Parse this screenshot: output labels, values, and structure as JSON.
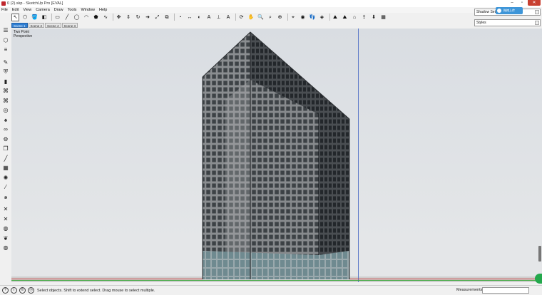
{
  "window": {
    "title": "0 (2).skp - SketchUp Pro [EVAL]",
    "minimize": "–",
    "maximize": "▫",
    "close": "✕"
  },
  "menu": [
    "File",
    "Edit",
    "View",
    "Camera",
    "Draw",
    "Tools",
    "Window",
    "Help"
  ],
  "toolbar": [
    {
      "name": "select-icon",
      "glyph": "↖",
      "selected": true
    },
    {
      "name": "make-component-icon",
      "glyph": "⬡"
    },
    {
      "name": "paint-bucket-icon",
      "glyph": "🪣"
    },
    {
      "name": "eraser-icon",
      "glyph": "◧"
    },
    {
      "sep": true
    },
    {
      "name": "rectangle-icon",
      "glyph": "▭"
    },
    {
      "name": "line-icon",
      "glyph": "╱"
    },
    {
      "name": "circle-icon",
      "glyph": "◯"
    },
    {
      "name": "arc-icon",
      "glyph": "◠"
    },
    {
      "name": "polygon-icon",
      "glyph": "⬟"
    },
    {
      "name": "freehand-icon",
      "glyph": "∿"
    },
    {
      "sep": true
    },
    {
      "name": "move-icon",
      "glyph": "✥"
    },
    {
      "name": "push-pull-icon",
      "glyph": "⇕"
    },
    {
      "name": "rotate-icon",
      "glyph": "↻"
    },
    {
      "name": "follow-me-icon",
      "glyph": "➜"
    },
    {
      "name": "scale-icon",
      "glyph": "⤢"
    },
    {
      "name": "offset-icon",
      "glyph": "⧉"
    },
    {
      "sep": true
    },
    {
      "name": "tape-measure-icon",
      "glyph": "◔"
    },
    {
      "name": "dimension-icon",
      "glyph": "↔"
    },
    {
      "name": "protractor-icon",
      "glyph": "◐"
    },
    {
      "name": "text-icon",
      "glyph": "A"
    },
    {
      "name": "axes-icon",
      "glyph": "⊥"
    },
    {
      "name": "3d-text-icon",
      "glyph": "A"
    },
    {
      "sep": true
    },
    {
      "name": "orbit-icon",
      "glyph": "⟳"
    },
    {
      "name": "pan-icon",
      "glyph": "✋"
    },
    {
      "name": "zoom-icon",
      "glyph": "🔍"
    },
    {
      "name": "zoom-window-icon",
      "glyph": "⌕"
    },
    {
      "name": "zoom-extents-icon",
      "glyph": "⊕"
    },
    {
      "sep": true
    },
    {
      "name": "position-camera-icon",
      "glyph": "⌖"
    },
    {
      "name": "look-around-icon",
      "glyph": "◉"
    },
    {
      "name": "walk-icon",
      "glyph": "👣"
    },
    {
      "name": "section-plane-icon",
      "glyph": "◈"
    },
    {
      "sep": true
    },
    {
      "name": "add-location-icon",
      "glyph": "⛰"
    },
    {
      "name": "toggle-terrain-icon",
      "glyph": "⛰"
    },
    {
      "name": "3d-warehouse-icon",
      "glyph": "⌂"
    },
    {
      "name": "share-model-icon",
      "glyph": "⇪"
    },
    {
      "name": "get-models-icon",
      "glyph": "⬇"
    },
    {
      "name": "extension-warehouse-icon",
      "glyph": "▦"
    }
  ],
  "scene_tabs": [
    {
      "label": "Scene 1",
      "active": true
    },
    {
      "label": "Scene 2",
      "active": false
    },
    {
      "label": "Scene 4",
      "active": false
    },
    {
      "label": "Scene 3",
      "active": false
    }
  ],
  "left_tools": [
    {
      "name": "move-tool-icon",
      "glyph": "☰"
    },
    {
      "name": "shapes-tool-icon",
      "glyph": "⬡"
    },
    {
      "name": "stairs-tool-icon",
      "glyph": "≡"
    },
    {
      "gap": true
    },
    {
      "name": "pencil-tool-icon",
      "glyph": "✎"
    },
    {
      "name": "shield-tool-icon",
      "glyph": "⛨"
    },
    {
      "name": "box-tool-icon",
      "glyph": "▮"
    },
    {
      "name": "nodes-tool-icon",
      "glyph": "⌘"
    },
    {
      "name": "nodes-alt-tool-icon",
      "glyph": "⌘"
    },
    {
      "name": "target-tool-icon",
      "glyph": "◎"
    },
    {
      "name": "flame-tool-icon",
      "glyph": "♠"
    },
    {
      "name": "chain-tool-icon",
      "glyph": "∞"
    },
    {
      "name": "gear-tool-icon",
      "glyph": "⚙"
    },
    {
      "name": "copy-tool-icon",
      "glyph": "❐"
    },
    {
      "name": "brush-tool-icon",
      "glyph": "╱"
    },
    {
      "name": "grid-tool-icon",
      "glyph": "▦"
    },
    {
      "name": "sun-tool-icon",
      "glyph": "✺"
    },
    {
      "name": "wand-tool-icon",
      "glyph": "⁄"
    },
    {
      "name": "spiral-tool-icon",
      "glyph": "๑"
    },
    {
      "gap": true
    },
    {
      "name": "cross-tool-icon",
      "glyph": "✕"
    },
    {
      "name": "cross-alt-tool-icon",
      "glyph": "✕"
    },
    {
      "name": "ring-tool-icon",
      "glyph": "◍"
    },
    {
      "name": "leaf-tool-icon",
      "glyph": "❦"
    },
    {
      "name": "globe-tool-icon",
      "glyph": "◍"
    }
  ],
  "viewport": {
    "view_name": "Two Point",
    "view_mode": "Perspective"
  },
  "tray": {
    "panels": [
      "Shadow Settings",
      "Styles"
    ],
    "overlay_label": "拖拽上传"
  },
  "status": {
    "icons": [
      "?",
      "i",
      "©",
      "◷"
    ],
    "message": "Select objects. Shift to extend select. Drag mouse to select multiple.",
    "measurements_label": "Measurements",
    "measurements_value": ""
  }
}
